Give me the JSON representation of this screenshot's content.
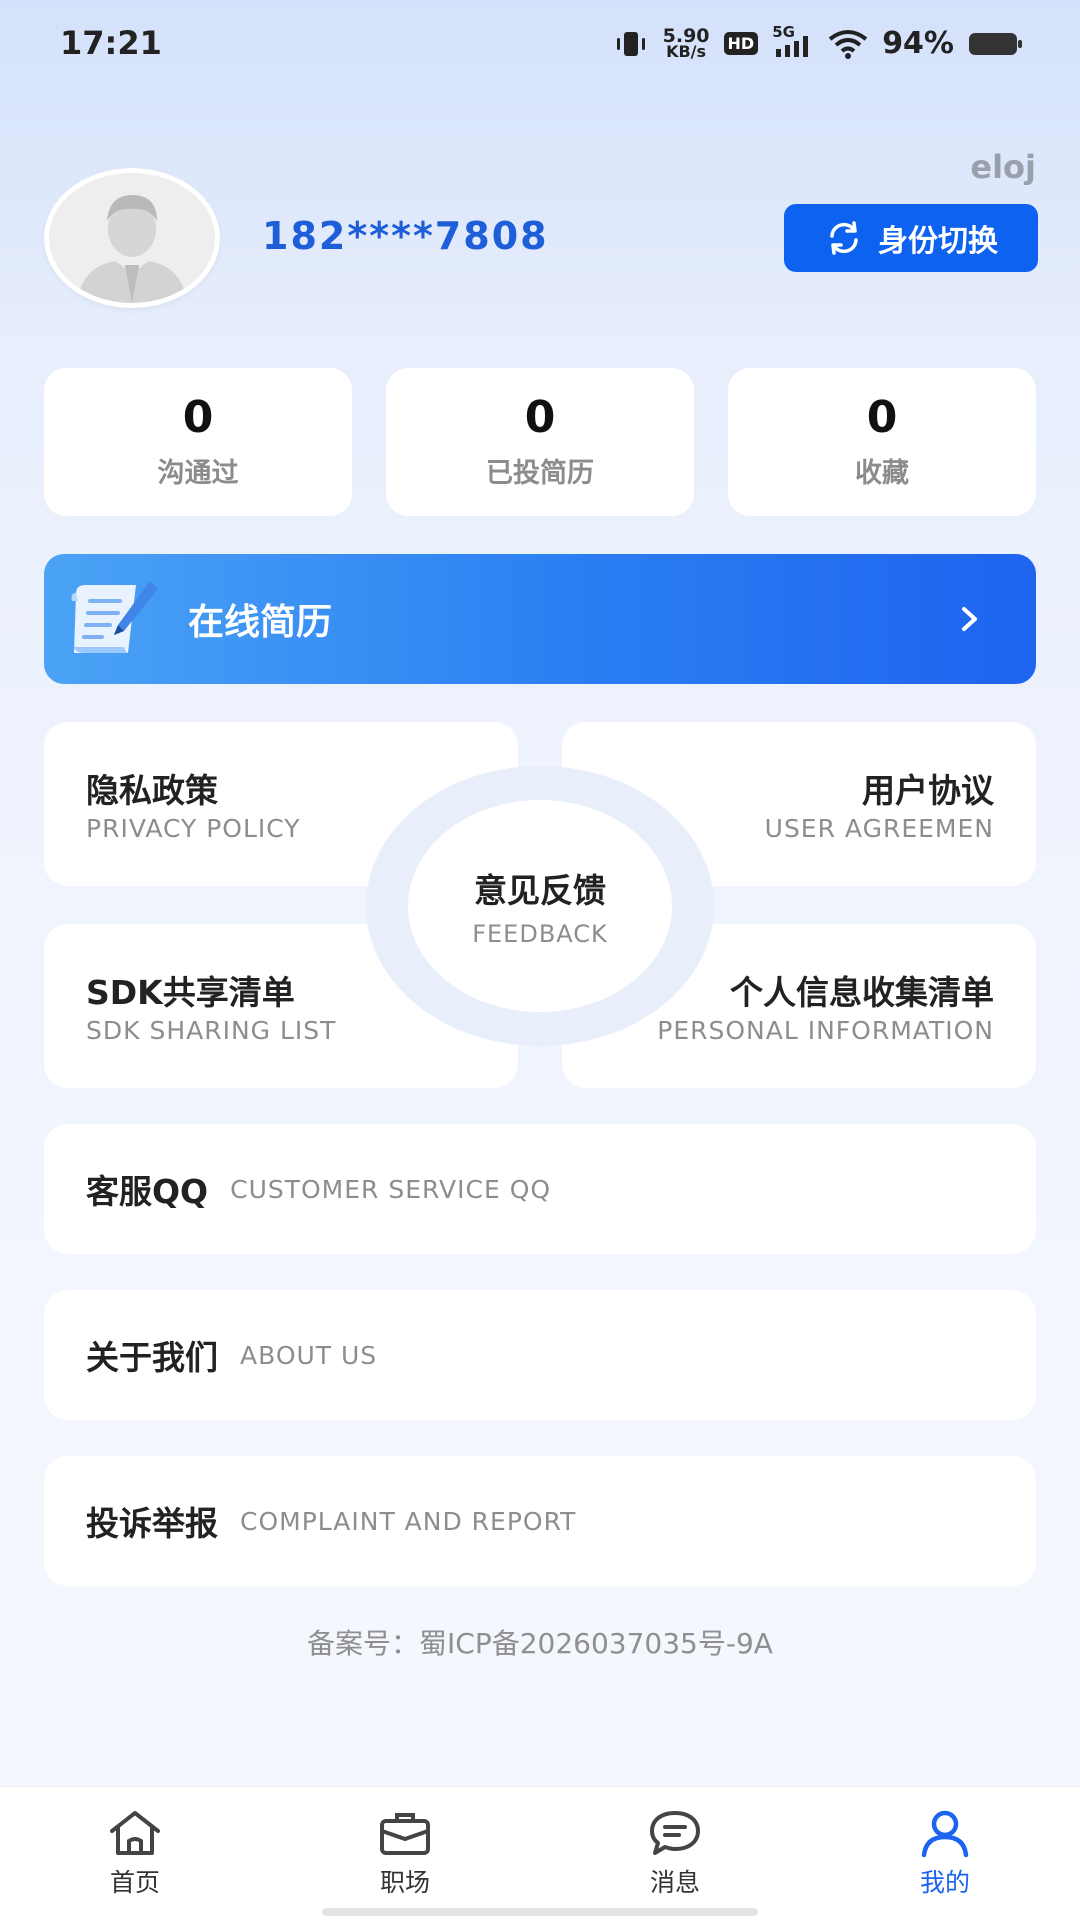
{
  "status_bar": {
    "time": "17:21",
    "net_speed_value": "5.90",
    "net_speed_unit": "KB/s",
    "hd": "HD",
    "network": "5G",
    "battery": "94%",
    "icons": [
      "vibrate-icon",
      "signal-icon",
      "wifi-icon",
      "battery-icon"
    ]
  },
  "profile": {
    "corner_tag": "eloj",
    "avatar_icon": "avatar-placeholder-icon",
    "phone": "182****7808",
    "switch_label": "身份切换",
    "switch_icon": "refresh-icon"
  },
  "stats": [
    {
      "value": "0",
      "label": "沟通过"
    },
    {
      "value": "0",
      "label": "已投简历"
    },
    {
      "value": "0",
      "label": "收藏"
    }
  ],
  "resume_banner": {
    "label": "在线简历",
    "icon": "document-pen-icon",
    "arrow_icon": "chevron-right-icon"
  },
  "grid": {
    "privacy": {
      "title": "隐私政策",
      "sub": "PRIVACY POLICY"
    },
    "agreement": {
      "title": "用户协议",
      "sub": "USER AGREEMEN"
    },
    "feedback": {
      "title": "意见反馈",
      "sub": "FEEDBACK"
    },
    "sdk": {
      "title": "SDK共享清单",
      "sub": "SDK SHARING LIST"
    },
    "personal": {
      "title": "个人信息收集清单",
      "sub": "PERSONAL INFORMATION"
    }
  },
  "list": [
    {
      "title": "客服QQ",
      "sub": "CUSTOMER SERVICE QQ"
    },
    {
      "title": "关于我们",
      "sub": "ABOUT US"
    },
    {
      "title": "投诉举报",
      "sub": "COMPLAINT AND REPORT"
    }
  ],
  "icp": "备案号：蜀ICP备2026037035号-9A",
  "bottom_nav": [
    {
      "label": "首页",
      "icon": "home-icon"
    },
    {
      "label": "职场",
      "icon": "briefcase-icon"
    },
    {
      "label": "消息",
      "icon": "chat-icon"
    },
    {
      "label": "我的",
      "icon": "user-icon",
      "active": true
    }
  ],
  "colors": {
    "accent": "#0d62f0",
    "phone": "#1e5ed8",
    "nav_active": "#1b63f0"
  }
}
